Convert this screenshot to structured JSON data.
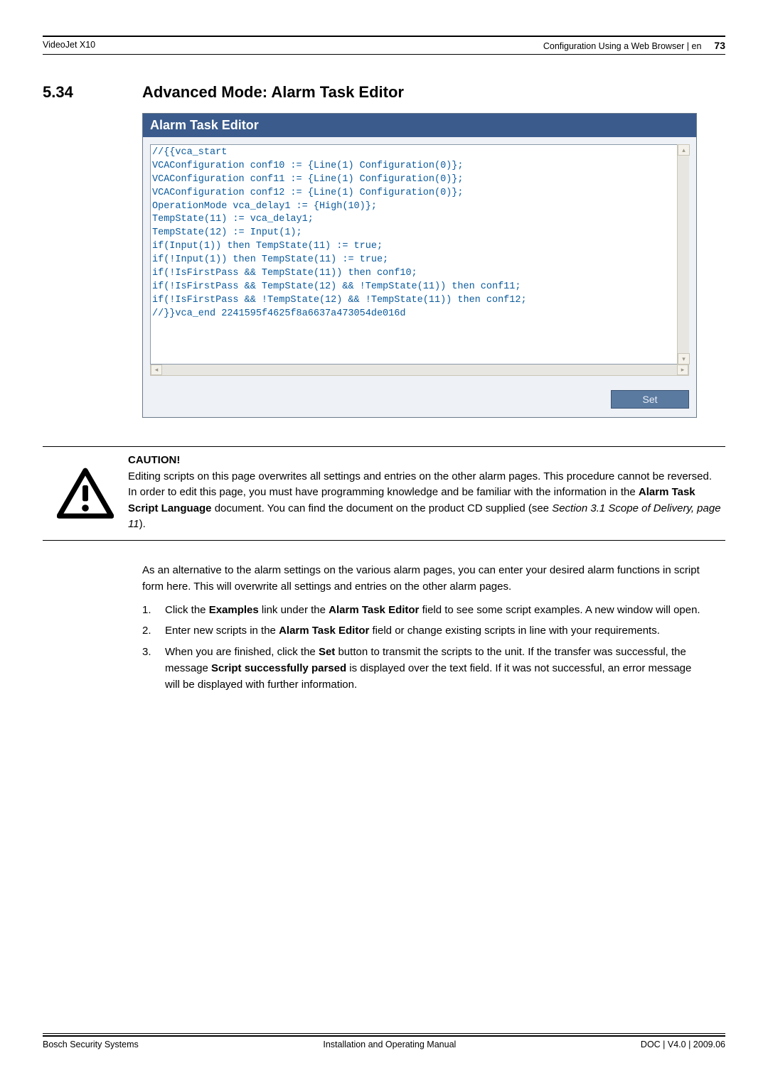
{
  "header": {
    "left": "VideoJet X10",
    "right_label": "Configuration Using a Web Browser | en",
    "page_number": "73"
  },
  "section": {
    "number": "5.34",
    "title": "Advanced Mode: Alarm Task Editor"
  },
  "panel": {
    "title": "Alarm Task Editor",
    "set_button": "Set",
    "code": "//{{vca_start\nVCAConfiguration conf10 := {Line(1) Configuration(0)};\nVCAConfiguration conf11 := {Line(1) Configuration(0)};\nVCAConfiguration conf12 := {Line(1) Configuration(0)};\nOperationMode vca_delay1 := {High(10)};\nTempState(11) := vca_delay1;\nTempState(12) := Input(1);\nif(Input(1)) then TempState(11) := true;\nif(!Input(1)) then TempState(11) := true;\nif(!IsFirstPass && TempState(11)) then conf10;\nif(!IsFirstPass && TempState(12) && !TempState(11)) then conf11;\nif(!IsFirstPass && !TempState(12) && !TempState(11)) then conf12;\n//}}vca_end 2241595f4625f8a6637a473054de016d"
  },
  "caution": {
    "heading": "CAUTION!",
    "p1": "Editing scripts on this page overwrites all settings and entries on the other alarm pages. This procedure cannot be reversed.",
    "p2a": "In order to edit this page, you must have programming knowledge and be familiar with the information in the ",
    "p2b": "Alarm Task Script Language",
    "p2c": " document. You can find the document on the product CD supplied (see ",
    "p2d": "Section 3.1 Scope of Delivery, page 11",
    "p2e": ")."
  },
  "body": {
    "intro": "As an alternative to the alarm settings on the various alarm pages, you can enter your desired alarm functions in script form here. This will overwrite all settings and entries on the other alarm pages.",
    "steps": {
      "s1a": "Click the ",
      "s1b": "Examples",
      "s1c": " link under the ",
      "s1d": "Alarm Task Editor",
      "s1e": " field to see some script examples. A new window will open.",
      "s2a": "Enter new scripts in the ",
      "s2b": "Alarm Task Editor",
      "s2c": " field or change existing scripts in line with your requirements.",
      "s3a": "When you are finished, click the ",
      "s3b": "Set",
      "s3c": " button to transmit the scripts to the unit. If the transfer was successful, the message ",
      "s3d": "Script successfully parsed",
      "s3e": " is displayed over the text field. If it was not successful, an error message will be displayed with further information."
    }
  },
  "footer": {
    "left": "Bosch Security Systems",
    "center": "Installation and Operating Manual",
    "right": "DOC | V4.0 | 2009.06"
  }
}
